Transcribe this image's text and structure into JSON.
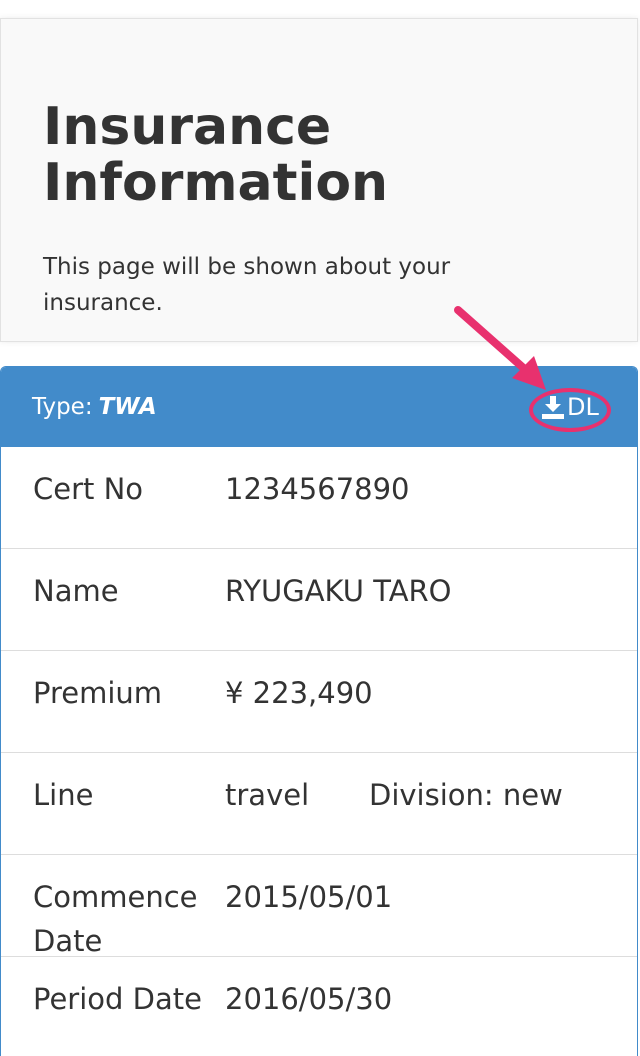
{
  "jumbotron": {
    "title": "Insurance Information",
    "description": "This page will be shown about your insurance."
  },
  "panel": {
    "type_label": "Type:",
    "type_value": "TWA",
    "download_label": "DL",
    "download_icon": "download-icon",
    "header_color": "#428bca",
    "highlight_color": "#e8316e"
  },
  "details": {
    "cert_no": {
      "label": "Cert No",
      "value": "1234567890"
    },
    "name": {
      "label": "Name",
      "value": "RYUGAKU TARO"
    },
    "premium": {
      "label": "Premium",
      "value": "¥ 223,490"
    },
    "line": {
      "label": "Line",
      "value": "travel",
      "division": "Division: new"
    },
    "commence_date": {
      "label": "Commence Date",
      "value": "2015/05/01"
    },
    "period_date": {
      "label": "Period Date",
      "value": "2016/05/30"
    }
  }
}
